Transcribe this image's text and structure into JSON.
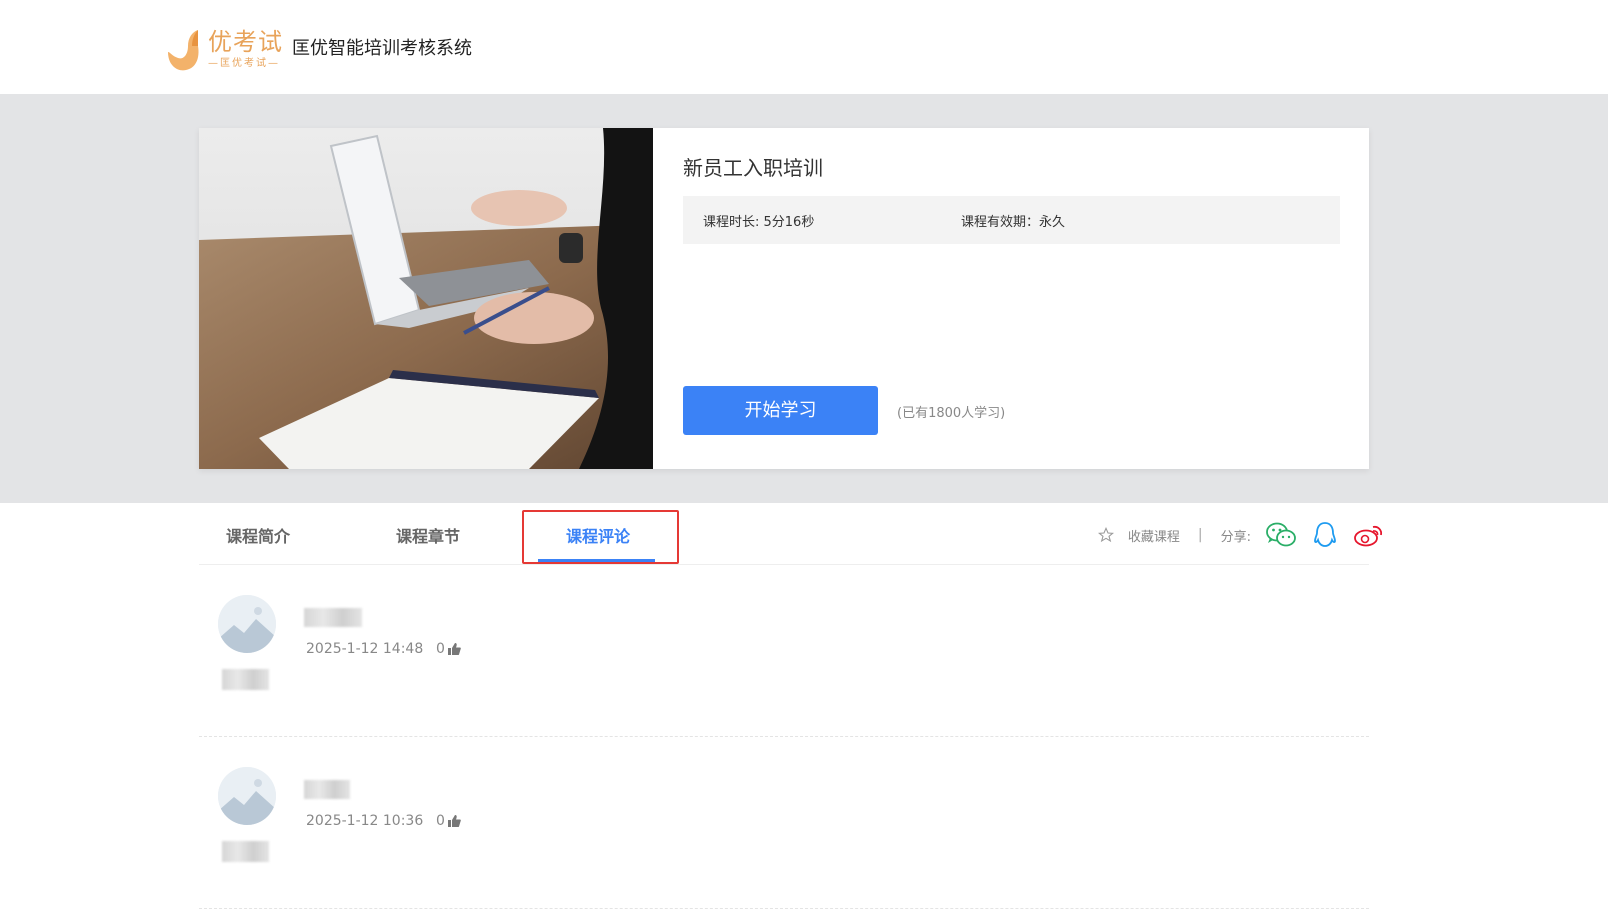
{
  "header": {
    "logo_text": "优考试",
    "logo_sub": "—匡优考试—",
    "system_title": "匡优智能培训考核系统"
  },
  "course": {
    "title": "新员工入职培训",
    "duration_label": "课程时长: 5分16秒",
    "validity_label": "课程有效期：永久",
    "start_button": "开始学习",
    "learners": "(已有1800人学习)"
  },
  "tabs": [
    {
      "label": "课程简介",
      "active": false
    },
    {
      "label": "课程章节",
      "active": false
    },
    {
      "label": "课程评论",
      "active": true
    }
  ],
  "actions": {
    "favorite": "收藏课程",
    "separator": "|",
    "share": "分享:",
    "share_icons": [
      "wechat-icon",
      "qq-icon",
      "weibo-icon"
    ]
  },
  "comments": [
    {
      "date": "2025-1-12 14:48",
      "likes": "0"
    },
    {
      "date": "2025-1-12 10:36",
      "likes": "0"
    }
  ],
  "colors": {
    "accent": "#3b82f6",
    "logo": "#e8a35a",
    "highlight": "#e53935",
    "wechat": "#2aae67",
    "qq": "#1e9bf0",
    "weibo": "#e6162d"
  }
}
